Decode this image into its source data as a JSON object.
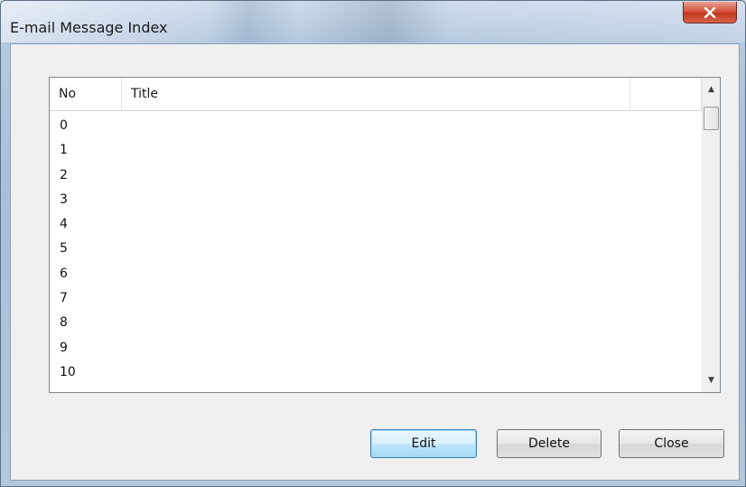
{
  "window": {
    "title": "E-mail Message Index"
  },
  "list": {
    "columns": [
      "No",
      "Title",
      ""
    ],
    "rows": [
      {
        "no": "0",
        "title": ""
      },
      {
        "no": "1",
        "title": ""
      },
      {
        "no": "2",
        "title": ""
      },
      {
        "no": "3",
        "title": ""
      },
      {
        "no": "4",
        "title": ""
      },
      {
        "no": "5",
        "title": ""
      },
      {
        "no": "6",
        "title": ""
      },
      {
        "no": "7",
        "title": ""
      },
      {
        "no": "8",
        "title": ""
      },
      {
        "no": "9",
        "title": ""
      },
      {
        "no": "10",
        "title": ""
      }
    ]
  },
  "buttons": {
    "edit": "Edit",
    "delete": "Delete",
    "close": "Close"
  },
  "icons": {
    "close": "close-icon",
    "scroll_up": "scroll-up-arrow-icon",
    "scroll_down": "scroll-down-arrow-icon"
  },
  "colors": {
    "close_button": "#c7432b",
    "default_button_border": "#3c7fb1"
  }
}
